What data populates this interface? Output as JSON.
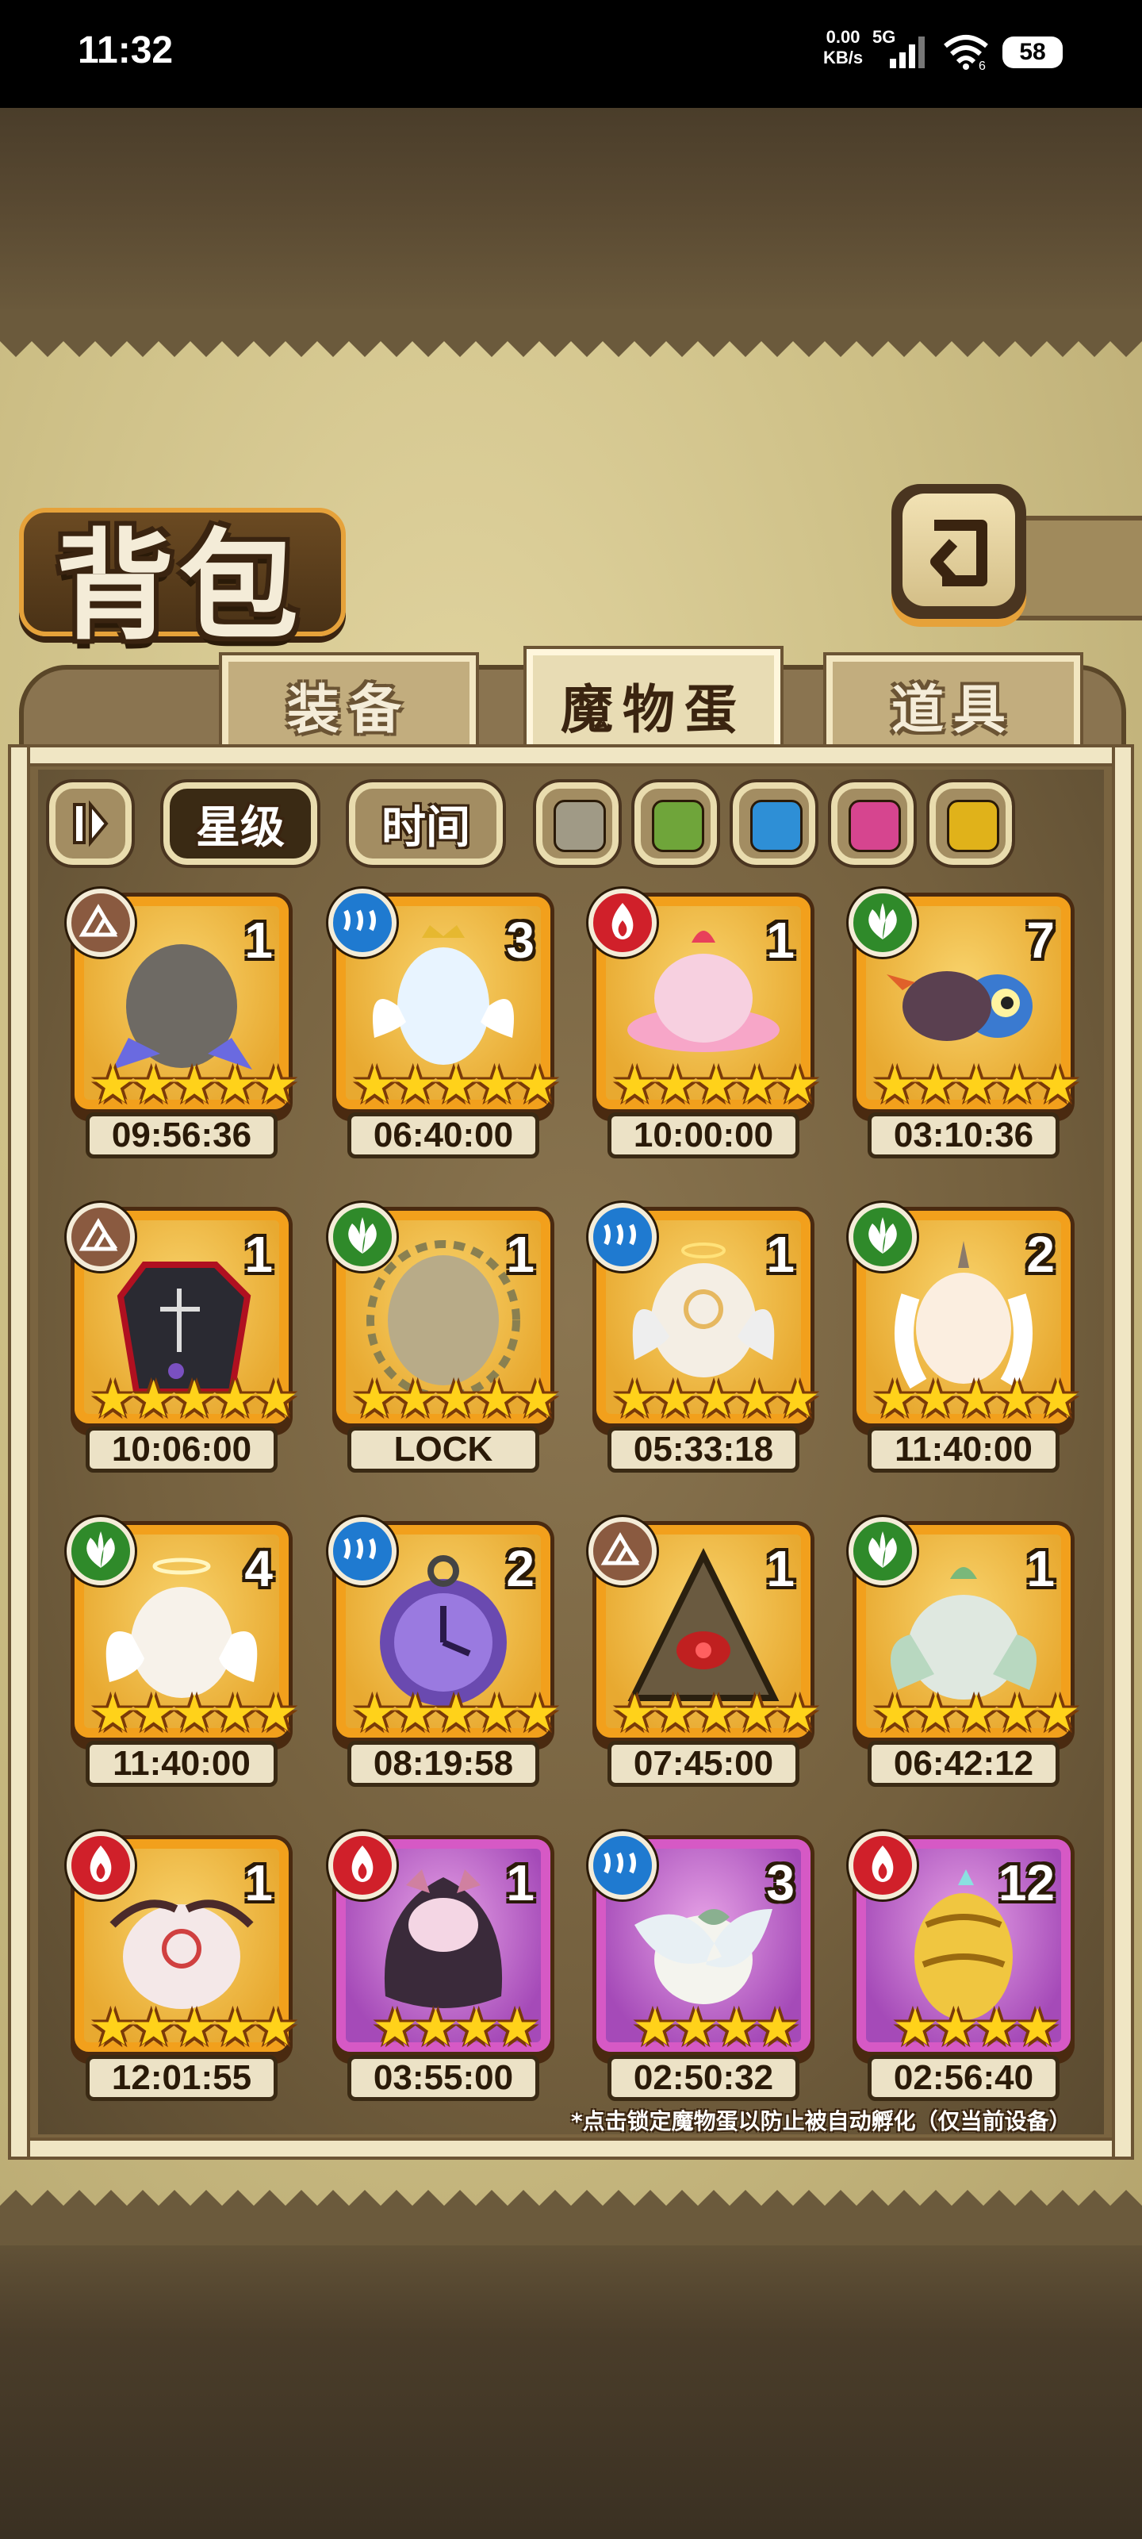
{
  "status_bar": {
    "time": "11:32",
    "net_speed_value": "0.00",
    "net_speed_unit": "KB/s",
    "network": "5G",
    "wifi_index": "6",
    "battery": "58"
  },
  "header": {
    "title": "背包",
    "back_icon": "return-arrow-icon"
  },
  "tabs": [
    {
      "label": "装备",
      "active": false
    },
    {
      "label": "魔物蛋",
      "active": true
    },
    {
      "label": "道具",
      "active": false
    }
  ],
  "filters": {
    "sort_icon": "pause-sort-icon",
    "sort_options": [
      {
        "label": "星级",
        "active": true
      },
      {
        "label": "时间",
        "active": false
      }
    ],
    "rarity_colors": [
      "#a09a86",
      "#6fa53a",
      "#2e8fd6",
      "#d6458f",
      "#e0b21a"
    ]
  },
  "element_colors": {
    "earth": "#8a5a40",
    "water": "#1f7ad0",
    "fire": "#d0202a",
    "nature": "#2f8a2a"
  },
  "eggs": [
    {
      "element": "earth",
      "count": "1",
      "stars": 5,
      "frame": "gold",
      "timer": "09:56:36"
    },
    {
      "element": "water",
      "count": "3",
      "stars": 5,
      "frame": "gold",
      "timer": "06:40:00"
    },
    {
      "element": "fire",
      "count": "1",
      "stars": 5,
      "frame": "gold",
      "timer": "10:00:00"
    },
    {
      "element": "nature",
      "count": "7",
      "stars": 5,
      "frame": "gold",
      "timer": "03:10:36"
    },
    {
      "element": "earth",
      "count": "1",
      "stars": 5,
      "frame": "gold",
      "timer": "10:06:00"
    },
    {
      "element": "nature",
      "count": "1",
      "stars": 5,
      "frame": "gold",
      "timer": "LOCK"
    },
    {
      "element": "water",
      "count": "1",
      "stars": 5,
      "frame": "gold",
      "timer": "05:33:18"
    },
    {
      "element": "nature",
      "count": "2",
      "stars": 5,
      "frame": "gold",
      "timer": "11:40:00"
    },
    {
      "element": "nature",
      "count": "4",
      "stars": 5,
      "frame": "gold",
      "timer": "11:40:00"
    },
    {
      "element": "water",
      "count": "2",
      "stars": 5,
      "frame": "gold",
      "timer": "08:19:58"
    },
    {
      "element": "earth",
      "count": "1",
      "stars": 5,
      "frame": "gold",
      "timer": "07:45:00"
    },
    {
      "element": "nature",
      "count": "1",
      "stars": 5,
      "frame": "gold",
      "timer": "06:42:12"
    },
    {
      "element": "fire",
      "count": "1",
      "stars": 5,
      "frame": "gold",
      "timer": "12:01:55"
    },
    {
      "element": "fire",
      "count": "1",
      "stars": 4,
      "frame": "purple",
      "timer": "03:55:00"
    },
    {
      "element": "water",
      "count": "3",
      "stars": 4,
      "frame": "purple",
      "timer": "02:50:32"
    },
    {
      "element": "fire",
      "count": "12",
      "stars": 4,
      "frame": "purple",
      "timer": "02:56:40"
    }
  ],
  "footnote": "*点击锁定魔物蛋以防止被自动孵化（仅当前设备）"
}
